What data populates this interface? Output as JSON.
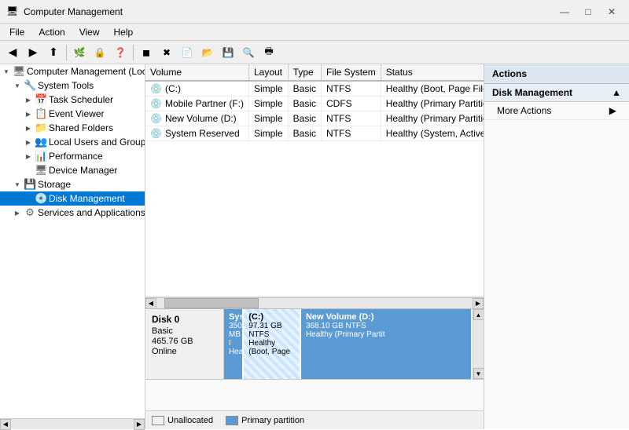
{
  "titleBar": {
    "icon": "🖥",
    "title": "Computer Management",
    "minimizeLabel": "—",
    "maximizeLabel": "□",
    "closeLabel": "✕"
  },
  "menuBar": {
    "items": [
      "File",
      "Action",
      "View",
      "Help"
    ]
  },
  "toolbar": {
    "buttons": [
      "◀",
      "▶",
      "⬆",
      "📋",
      "🔒",
      "❓",
      "⬛",
      "✖",
      "📄",
      "📂",
      "💾",
      "🔍",
      "🖶"
    ]
  },
  "leftPane": {
    "scrollLeft": "◀",
    "scrollRight": "▶",
    "tree": [
      {
        "id": "root",
        "label": "Computer Management (Local",
        "level": 0,
        "expand": "▼",
        "icon": "🖥",
        "selected": false
      },
      {
        "id": "system-tools",
        "label": "System Tools",
        "level": 1,
        "expand": "▼",
        "icon": "🔧",
        "selected": false
      },
      {
        "id": "task-scheduler",
        "label": "Task Scheduler",
        "level": 2,
        "expand": "▶",
        "icon": "📅",
        "selected": false
      },
      {
        "id": "event-viewer",
        "label": "Event Viewer",
        "level": 2,
        "expand": "▶",
        "icon": "📋",
        "selected": false
      },
      {
        "id": "shared-folders",
        "label": "Shared Folders",
        "level": 2,
        "expand": "▶",
        "icon": "📁",
        "selected": false
      },
      {
        "id": "local-users",
        "label": "Local Users and Groups",
        "level": 2,
        "expand": "▶",
        "icon": "👥",
        "selected": false
      },
      {
        "id": "performance",
        "label": "Performance",
        "level": 2,
        "expand": "▶",
        "icon": "📊",
        "selected": false
      },
      {
        "id": "device-manager",
        "label": "Device Manager",
        "level": 2,
        "expand": "",
        "icon": "🖥",
        "selected": false
      },
      {
        "id": "storage",
        "label": "Storage",
        "level": 1,
        "expand": "▼",
        "icon": "💾",
        "selected": false
      },
      {
        "id": "disk-management",
        "label": "Disk Management",
        "level": 2,
        "expand": "",
        "icon": "💿",
        "selected": true
      },
      {
        "id": "services-apps",
        "label": "Services and Applications",
        "level": 1,
        "expand": "▶",
        "icon": "⚙",
        "selected": false
      }
    ]
  },
  "volumeTable": {
    "columns": [
      "Volume",
      "Layout",
      "Type",
      "File System",
      "Status"
    ],
    "rows": [
      {
        "icon": "💿",
        "volume": "(C:)",
        "layout": "Simple",
        "type": "Basic",
        "filesystem": "NTFS",
        "status": "Healthy (Boot, Page File, Cras"
      },
      {
        "icon": "💿",
        "volume": "Mobile Partner (F:)",
        "layout": "Simple",
        "type": "Basic",
        "filesystem": "CDFS",
        "status": "Healthy (Primary Partition)"
      },
      {
        "icon": "💿",
        "volume": "New Volume (D:)",
        "layout": "Simple",
        "type": "Basic",
        "filesystem": "NTFS",
        "status": "Healthy (Primary Partition)"
      },
      {
        "icon": "💿",
        "volume": "System Reserved",
        "layout": "Simple",
        "type": "Basic",
        "filesystem": "NTFS",
        "status": "Healthy (System, Active, Prim"
      }
    ]
  },
  "diskView": {
    "disks": [
      {
        "name": "Disk 0",
        "type": "Basic",
        "size": "465.76 GB",
        "status": "Online",
        "partitions": [
          {
            "id": "system",
            "name": "System",
            "size": "350 MB I",
            "fs": "",
            "status": "Healthy",
            "type": "system-reserved"
          },
          {
            "id": "c",
            "name": "(C:)",
            "size": "97.31 GB NTFS",
            "fs": "",
            "status": "Healthy (Boot, Page",
            "type": "c-drive"
          },
          {
            "id": "newvol",
            "name": "New Volume  (D:)",
            "size": "368.10 GB NTFS",
            "fs": "",
            "status": "Healthy (Primary Partit",
            "type": "new-volume"
          }
        ]
      }
    ]
  },
  "legend": {
    "items": [
      {
        "type": "unallocated",
        "label": "Unallocated"
      },
      {
        "type": "primary",
        "label": "Primary partition"
      }
    ]
  },
  "actionsPane": {
    "header": "Actions",
    "sections": [
      {
        "label": "Disk Management",
        "expanded": true,
        "items": [
          {
            "label": "More Actions",
            "hasArrow": true
          }
        ]
      }
    ]
  },
  "scrollbar": {
    "leftBtn": "◀",
    "rightBtn": "▶"
  }
}
